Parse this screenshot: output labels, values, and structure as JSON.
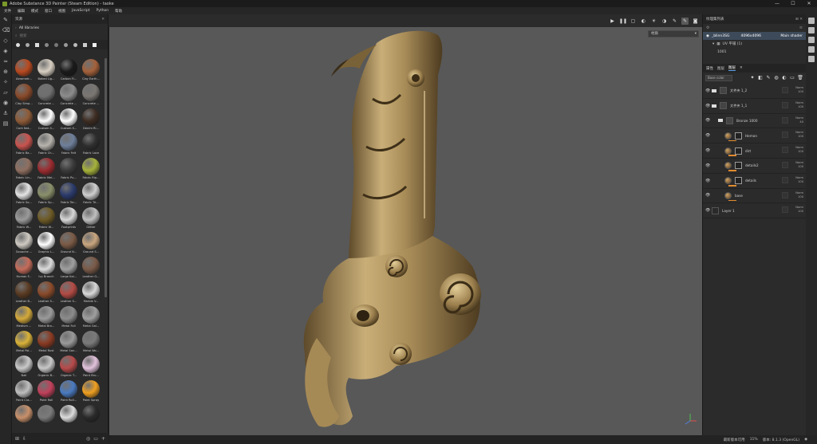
{
  "window": {
    "title": "Adobe Substance 3D Painter (Steam Edition) - taoke",
    "controls": [
      "—",
      "☐",
      "✕"
    ]
  },
  "menu": [
    "文件",
    "编辑",
    "模式",
    "窗口",
    "视图",
    "JavaScript",
    "Python",
    "帮助"
  ],
  "shelf": {
    "title": "资源",
    "path": "All libraries",
    "search_placeholder": "搜索",
    "items": [
      {
        "label": "Aerometr...",
        "color": "#b8491f"
      },
      {
        "label": "Baked Lig...",
        "color": "#d8cfc2"
      },
      {
        "label": "Carbon Fi...",
        "color": "#1a1a1a"
      },
      {
        "label": "Clay Earth...",
        "color": "#a4613a"
      },
      {
        "label": "Clay Simp...",
        "color": "#8a4a2a"
      },
      {
        "label": "Concrete ...",
        "color": "#6f6f6f"
      },
      {
        "label": "Concrete ...",
        "color": "#8c8c8c"
      },
      {
        "label": "Concrete ...",
        "color": "#7a7672"
      },
      {
        "label": "Cork Nat...",
        "color": "#8e5b38"
      },
      {
        "label": "Custom S...",
        "color": "#ffffff"
      },
      {
        "label": "Custom S...",
        "color": "#ffffff"
      },
      {
        "label": "Denim Ri...",
        "color": "#3d2c22"
      },
      {
        "label": "Fabric Ba...",
        "color": "#c9534e"
      },
      {
        "label": "Fabric Ch...",
        "color": "#b7b3ad"
      },
      {
        "label": "Fabric Felt",
        "color": "#6e7f9a"
      },
      {
        "label": "Fabric Lace",
        "color": "#2f2f2f"
      },
      {
        "label": "Fabric Lin...",
        "color": "#8f6f60"
      },
      {
        "label": "Fabric Mel...",
        "color": "#9b2b2f"
      },
      {
        "label": "Fabric Pu...",
        "color": "#3a3a3a"
      },
      {
        "label": "Fabric Rip...",
        "color": "#a6b23a"
      },
      {
        "label": "Fabric So...",
        "color": "#e4e4e4"
      },
      {
        "label": "Fabric Sp...",
        "color": "#8a8f6a"
      },
      {
        "label": "Fabric Tar...",
        "color": "#2a3a6a"
      },
      {
        "label": "Fabric Tri...",
        "color": "#cfcfcf"
      },
      {
        "label": "Fabric W...",
        "color": "#9a9a9a"
      },
      {
        "label": "Fabric W...",
        "color": "#6d5a25"
      },
      {
        "label": "Footprints",
        "color": "#d8d8d8"
      },
      {
        "label": "Glitter",
        "color": "#bfbfbf"
      },
      {
        "label": "Gouache ...",
        "color": "#cfcac2"
      },
      {
        "label": "Graphic L...",
        "color": "#ffffff"
      },
      {
        "label": "Ground N...",
        "color": "#7a5a45"
      },
      {
        "label": "Ground S...",
        "color": "#c9a67f"
      },
      {
        "label": "Human F...",
        "color": "#c56b5a"
      },
      {
        "label": "Ivy Branch",
        "color": "#dcdcdc"
      },
      {
        "label": "Large Kai...",
        "color": "#a0a0a0"
      },
      {
        "label": "Leather G...",
        "color": "#7a5a48"
      },
      {
        "label": "Leather B...",
        "color": "#5a3b22"
      },
      {
        "label": "Leather S...",
        "color": "#8a4a2a"
      },
      {
        "label": "Leather S...",
        "color": "#b34a44"
      },
      {
        "label": "Marble V...",
        "color": "#d9d9d9"
      },
      {
        "label": "Medium ...",
        "color": "#d3a93a"
      },
      {
        "label": "Metal Bro...",
        "color": "#9a9a9a"
      },
      {
        "label": "Metal Foil",
        "color": "#8c8c8c"
      },
      {
        "label": "Metal Gal...",
        "color": "#9f9f9f"
      },
      {
        "label": "Metal Pol...",
        "color": "#d9b238"
      },
      {
        "label": "Metal Rust",
        "color": "#8a3a22"
      },
      {
        "label": "Metal San...",
        "color": "#9a9a9a"
      },
      {
        "label": "Metal Wo...",
        "color": "#7a7a7a"
      },
      {
        "label": "Nail",
        "color": "#c9c9c9"
      },
      {
        "label": "Organic B...",
        "color": "#c8c8c8"
      },
      {
        "label": "Organic T...",
        "color": "#b84a4a"
      },
      {
        "label": "Paint Bru...",
        "color": "#e2c2dc"
      },
      {
        "label": "Paint Cra...",
        "color": "#bfbfbf"
      },
      {
        "label": "Paint Roll",
        "color": "#c0405a"
      },
      {
        "label": "Paint Roll...",
        "color": "#4a7ac0"
      },
      {
        "label": "Paint Spray",
        "color": "#f0a020"
      },
      {
        "label": "",
        "color": "#c8906a"
      },
      {
        "label": "",
        "color": "#7a7a7a"
      },
      {
        "label": "",
        "color": "#dcdcdc"
      },
      {
        "label": "",
        "color": "#2a2a2a"
      }
    ]
  },
  "viewport": {
    "view_dropdown": "材质",
    "model_color": "#b0955f"
  },
  "texture_set": {
    "title": "纹理集列表",
    "name": "_blinn3SG",
    "resolution": "4096x4096",
    "shader": "Main shader",
    "uv_label": "UV 平铺 (1)",
    "tile": "1001"
  },
  "layers": {
    "tabs": [
      "属性",
      "图层",
      "图层"
    ],
    "active_tab": 2,
    "blend_mode": "Base color",
    "items": [
      {
        "name": "文件夹 1_2",
        "type": "folder",
        "indent": 0,
        "blend": "Norm",
        "opacity": "100"
      },
      {
        "name": "文件夹 1_1",
        "type": "folder",
        "indent": 0,
        "blend": "Norm",
        "opacity": "100"
      },
      {
        "name": "Bronze 1000",
        "type": "folder",
        "indent": 1,
        "blend": "Norm",
        "opacity": "40"
      },
      {
        "name": "Hemon",
        "type": "fill",
        "indent": 2,
        "blend": "Norm",
        "opacity": "100"
      },
      {
        "name": "dirt",
        "type": "fill",
        "indent": 2,
        "blend": "Norm",
        "opacity": "100"
      },
      {
        "name": "details2",
        "type": "fill",
        "indent": 2,
        "blend": "Norm",
        "opacity": "100"
      },
      {
        "name": "details",
        "type": "fill",
        "indent": 2,
        "blend": "Norm",
        "opacity": "100"
      },
      {
        "name": "base",
        "type": "fill",
        "indent": 2,
        "blend": "Norm",
        "opacity": "100"
      },
      {
        "name": "Layer 1",
        "type": "paint",
        "indent": 0,
        "blend": "Norm",
        "opacity": "100"
      }
    ]
  },
  "status": {
    "message": "最新版本可用",
    "cache": "11%",
    "version": "版本: 8.1.3 (OpenGL)"
  }
}
